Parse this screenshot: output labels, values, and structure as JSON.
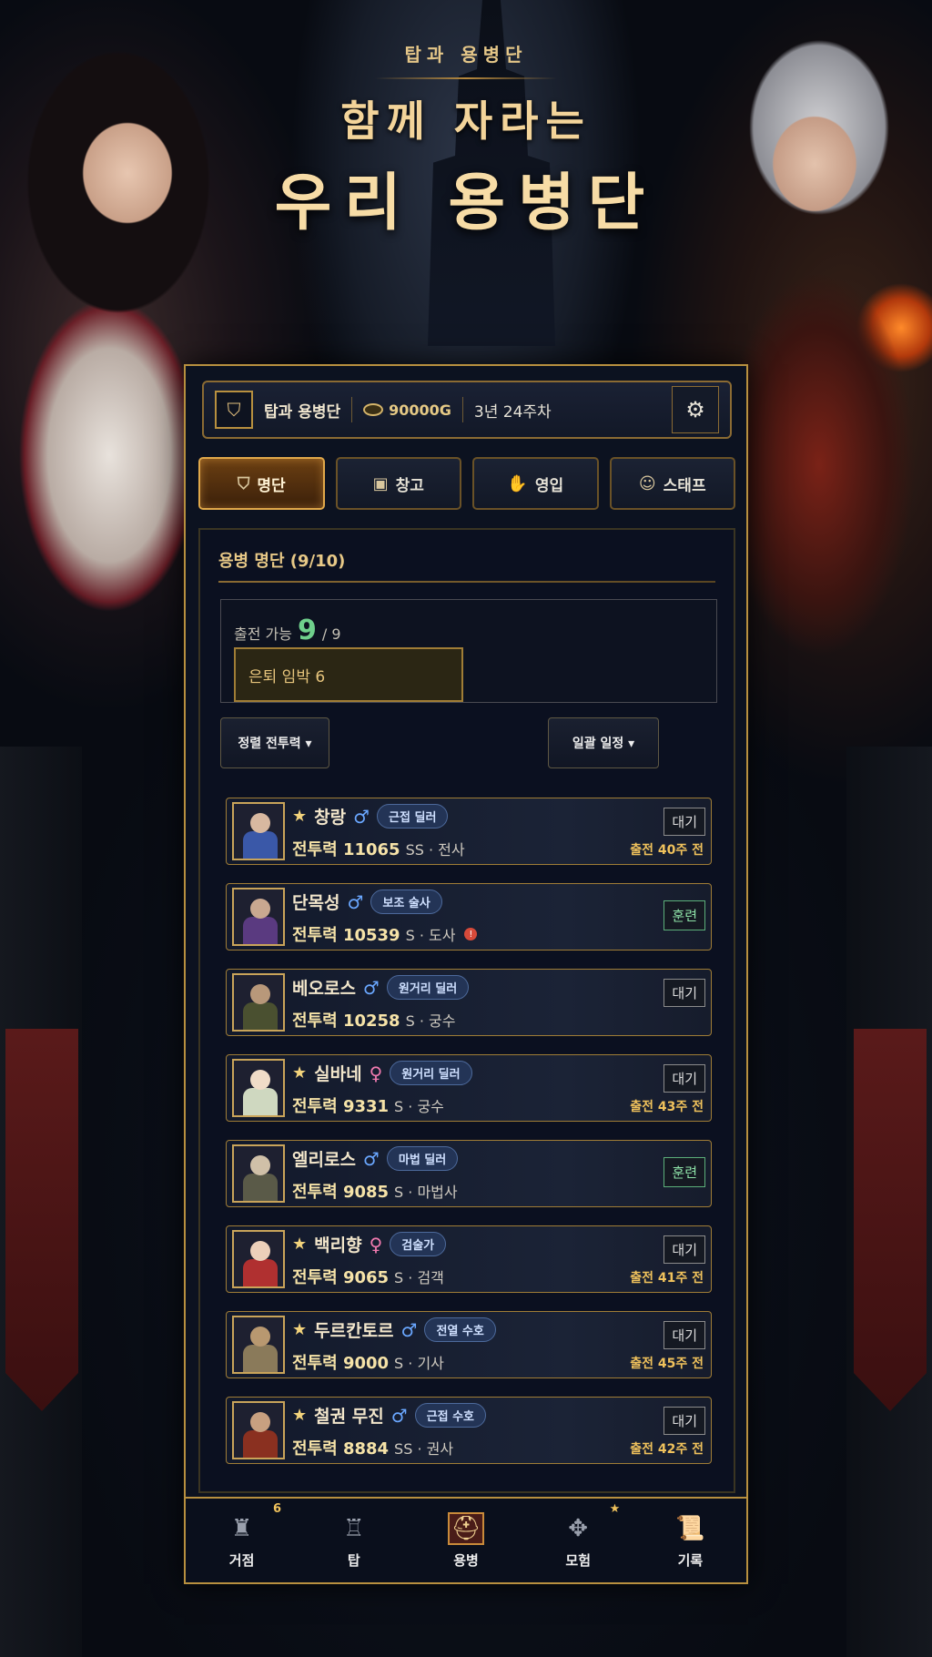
{
  "hero": {
    "subtitle": "탑과 용병단",
    "line1": "함께 자라는",
    "line2": "우리 용병단"
  },
  "topbar": {
    "guild_name": "탑과 용병단",
    "gold": "90000G",
    "date": "3년 24주차"
  },
  "tabs": [
    {
      "label": "명단",
      "icon": "shield-icon",
      "active": true
    },
    {
      "label": "창고",
      "icon": "box-icon",
      "active": false
    },
    {
      "label": "영입",
      "icon": "handshake-icon",
      "active": false
    },
    {
      "label": "스태프",
      "icon": "people-icon",
      "active": false
    }
  ],
  "roster": {
    "title": "용병 명단 (9/10)",
    "available_label": "출전 가능",
    "available_count": "9",
    "available_total": "/ 9",
    "retire_label": "은퇴 임박 6",
    "sort_label": "정렬 전투력 ▾",
    "schedule_label": "일괄 일정 ▾",
    "mercenaries": [
      {
        "starred": true,
        "name": "창랑",
        "gender": "♂",
        "role": "근접 딜러",
        "power": "전투력 11065",
        "rank": "SS · 전사",
        "status": "대기",
        "deploy": "출전 40주 전",
        "head": "#d8b8a0",
        "body": "#3a58a8"
      },
      {
        "starred": false,
        "name": "단목성",
        "gender": "♂",
        "role": "보조 술사",
        "power": "전투력 10539",
        "rank": "S · 도사",
        "status": "훈련",
        "deploy": "",
        "warn": "!",
        "head": "#c9a890",
        "body": "#5a3a80"
      },
      {
        "starred": false,
        "name": "베오로스",
        "gender": "♂",
        "role": "원거리 딜러",
        "power": "전투력 10258",
        "rank": "S · 궁수",
        "status": "대기",
        "deploy": "",
        "head": "#b8987a",
        "body": "#4a5030"
      },
      {
        "starred": true,
        "name": "실바네",
        "gender": "♀",
        "role": "원거리 딜러",
        "power": "전투력 9331",
        "rank": "S · 궁수",
        "status": "대기",
        "deploy": "출전 43주 전",
        "head": "#f0dcc8",
        "body": "#cfd8c0"
      },
      {
        "starred": false,
        "name": "엘리로스",
        "gender": "♂",
        "role": "마법 딜러",
        "power": "전투력 9085",
        "rank": "S · 마법사",
        "status": "훈련",
        "deploy": "",
        "head": "#d0c0a8",
        "body": "#5a5a48"
      },
      {
        "starred": true,
        "name": "백리향",
        "gender": "♀",
        "role": "검술가",
        "power": "전투력 9065",
        "rank": "S · 검객",
        "status": "대기",
        "deploy": "출전 41주 전",
        "head": "#ecd0ba",
        "body": "#b03030"
      },
      {
        "starred": true,
        "name": "두르칸토르",
        "gender": "♂",
        "role": "전열 수호",
        "power": "전투력 9000",
        "rank": "S · 기사",
        "status": "대기",
        "deploy": "출전 45주 전",
        "head": "#b89870",
        "body": "#8a7a5a"
      },
      {
        "starred": true,
        "name": "철권 무진",
        "gender": "♂",
        "role": "근접 수호",
        "power": "전투력 8884",
        "rank": "SS · 권사",
        "status": "대기",
        "deploy": "출전 42주 전",
        "head": "#c8a080",
        "body": "#8a3020"
      }
    ]
  },
  "nav": [
    {
      "label": "거점",
      "icon": "castle-icon",
      "badge": "6",
      "active": false
    },
    {
      "label": "탑",
      "icon": "tower-icon",
      "badge": "",
      "active": false
    },
    {
      "label": "용병",
      "icon": "helmet-icon",
      "badge": "",
      "active": true
    },
    {
      "label": "모험",
      "icon": "compass-icon",
      "badge": "★",
      "active": false
    },
    {
      "label": "기록",
      "icon": "scroll-icon",
      "badge": "",
      "active": false
    }
  ]
}
